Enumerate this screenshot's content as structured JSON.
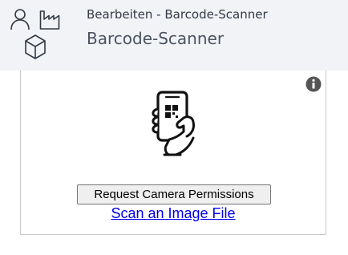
{
  "header": {
    "subtitle": "Bearbeiten - Barcode-Scanner",
    "title": "Barcode-Scanner",
    "icons": [
      "user-icon",
      "factory-icon",
      "box-icon"
    ]
  },
  "scanner": {
    "info_icon": "info-icon",
    "illustration": "phone-in-hand-qr-icon",
    "permission_button_label": "Request Camera Permissions",
    "scan_file_link_label": "Scan an Image File"
  },
  "colors": {
    "header_background": "#f2f3f7",
    "link": "#0000ee",
    "icon_stroke": "#333a44"
  }
}
